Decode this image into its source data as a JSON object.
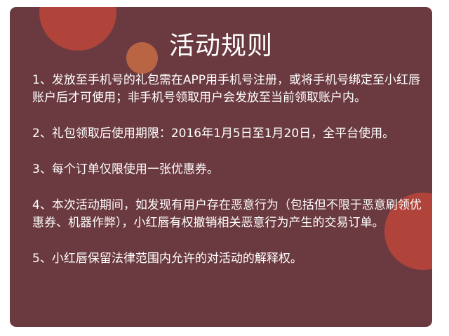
{
  "title": "活动规则",
  "rules": [
    "1、发放至手机号的礼包需在APP用手机号注册，或将手机号绑定至小红唇账户后才可使用；非手机号领取用户会发放至当前领取账户内。",
    "2、礼包领取后使用期限：2016年1月5日至1月20日，全平台使用。",
    "3、每个订单仅限使用一张优惠券。",
    "4、本次活动期间，如发现有用户存在恶意行为（包括但不限于恶意刷领优惠券、机器作弊），小红唇有权撤销相关恶意行为产生的交易订单。",
    "5、小红唇保留法律范围内允许的对活动的解释权。"
  ],
  "colors": {
    "panel": "#6b3a40",
    "bubble": "#b8463b",
    "bubble_small": "#c26a45",
    "text": "#ffffff"
  }
}
